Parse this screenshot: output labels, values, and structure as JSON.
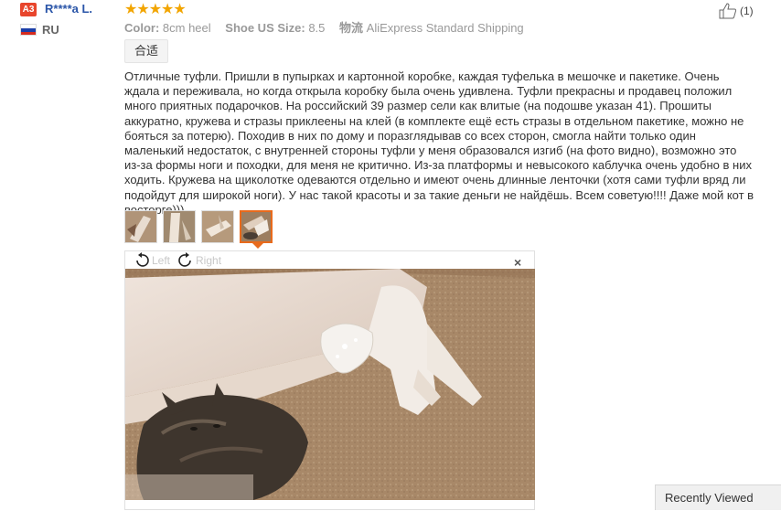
{
  "reviewer": {
    "level": "A3",
    "name": "R****a L.",
    "country": "RU"
  },
  "rating": {
    "stars": "★★★★★"
  },
  "attributes": [
    {
      "label": "Color:",
      "value": "8cm heel"
    },
    {
      "label": "Shoe US Size:",
      "value": "8.5"
    },
    {
      "label": "物流",
      "value": "AliExpress Standard Shipping"
    }
  ],
  "tag": "合适",
  "helpful": {
    "count": "(1)"
  },
  "review": "Отличные туфли. Пришли в пупырках и картонной коробке, каждая туфелька в мешочке и пакетике. Очень ждала и переживала, но когда открыла коробку была очень удивлена. Туфли прекрасны и продавец положил много приятных подарочков. На российский 39 размер сели как влитые (на подошве указан 41). Прошиты аккуратно, кружева и стразы приклеены на клей (в комплекте ещё есть стразы в отдельном пакетике, можно не бояться за потерю). Походив в них по дому и поразглядывав со всех сторон, смогла найти только один маленький недостаток, с внутренней стороны туфли у меня образовался изгиб (на фото видно), возможно это из-за формы ноги и походки, для меня не критично. Из-за платформы и невысокого каблучка очень удобно в них ходить. Кружева на щиколотке одеваются отдельно и имеют очень длинные ленточки (хотя сами туфли вряд ли подойдут для широкой ноги). У нас такой красоты и за такие деньги не найдёшь. Всем советую!!!! Даже мой кот в восторге)))",
  "viewer": {
    "left_label": "Left",
    "right_label": "Right",
    "close": "×"
  },
  "recently_viewed": "Recently Viewed",
  "colors": {
    "badge": "#e8452c",
    "username": "#2a55a8",
    "stars": "#f2a500",
    "active_thumb": "#e86a1c"
  }
}
